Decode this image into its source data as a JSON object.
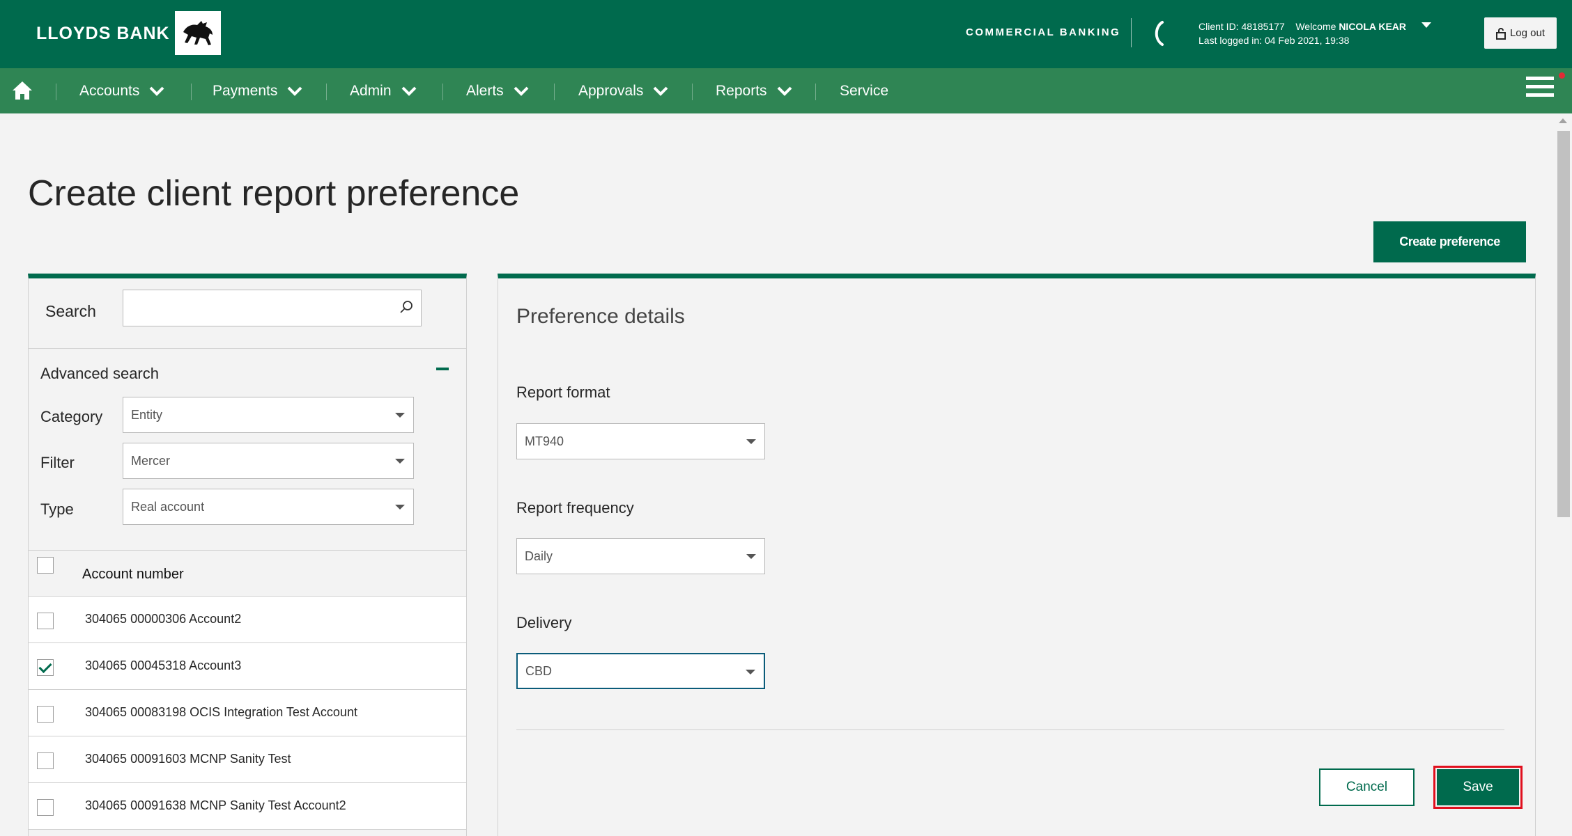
{
  "header": {
    "brand": "LLOYDS BANK",
    "section": "COMMERCIAL BANKING",
    "client_id": "Client ID: 48185177",
    "welcome_prefix": "Welcome",
    "user_name": "NICOLA KEAR",
    "last_logged": "Last logged in: 04 Feb 2021, 19:38",
    "logout_label": "Log out"
  },
  "nav": {
    "items": [
      "Accounts",
      "Payments",
      "Admin",
      "Alerts",
      "Approvals",
      "Reports",
      "Service"
    ]
  },
  "page": {
    "title": "Create client report preference",
    "create_button": "Create preference"
  },
  "left": {
    "search_label": "Search",
    "search_placeholder": "",
    "advanced_label": "Advanced search",
    "category_label": "Category",
    "category_value": "Entity",
    "filter_label": "Filter",
    "filter_value": "Mercer",
    "type_label": "Type",
    "type_value": "Real account",
    "account_header": "Account number",
    "accounts": [
      {
        "label": "304065 00000306 Account2",
        "checked": false
      },
      {
        "label": "304065 00045318 Account3",
        "checked": true
      },
      {
        "label": "304065 00083198 OCIS Integration Test Account",
        "checked": false
      },
      {
        "label": "304065 00091603 MCNP Sanity Test",
        "checked": false
      },
      {
        "label": "304065 00091638 MCNP Sanity Test Account2",
        "checked": false
      }
    ]
  },
  "right": {
    "title": "Preference details",
    "format_label": "Report format",
    "format_value": "MT940",
    "frequency_label": "Report frequency",
    "frequency_value": "Daily",
    "delivery_label": "Delivery",
    "delivery_value": "CBD",
    "cancel_label": "Cancel",
    "save_label": "Save"
  },
  "colors": {
    "header_green": "#006a4d",
    "nav_green": "#2f8554",
    "highlight_red": "#e0101e"
  }
}
